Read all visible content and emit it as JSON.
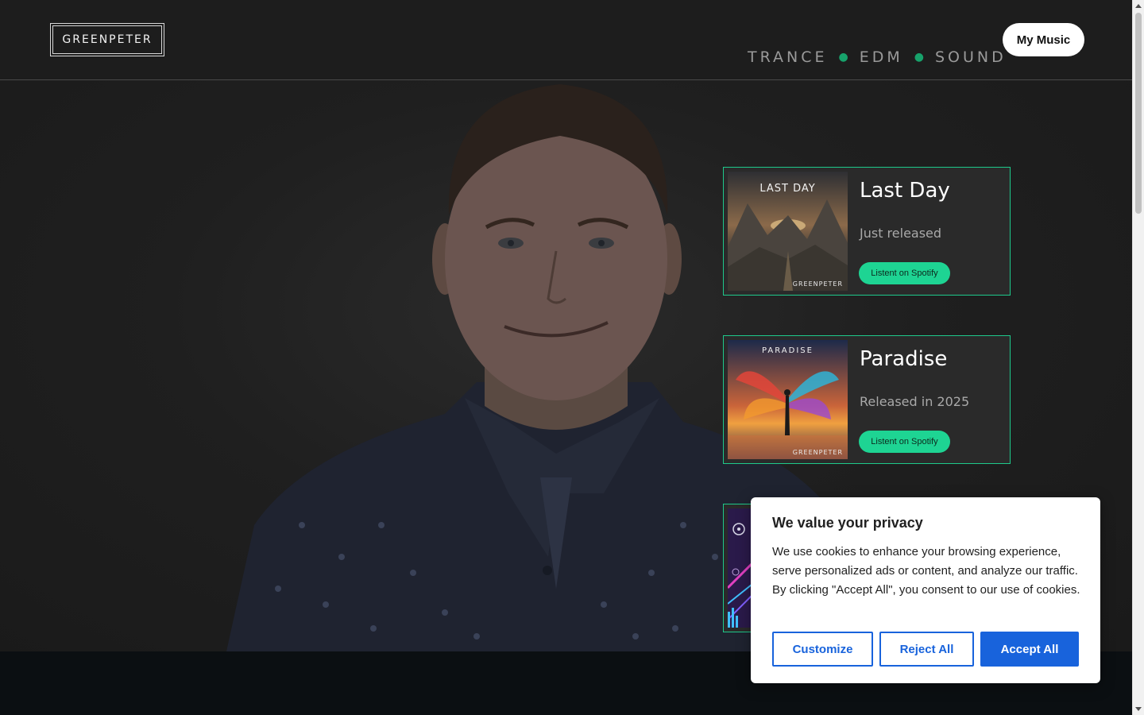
{
  "header": {
    "logo": "GREENPETER",
    "tagline": [
      "TRANCE",
      "EDM",
      "SOUND"
    ],
    "my_music": "My Music"
  },
  "releases": [
    {
      "cover_text": "LAST DAY",
      "cover_brand": "GREENPETER",
      "title": "Last Day",
      "subtitle": "Just released",
      "button": "Listent on Spotify"
    },
    {
      "cover_text": "PARADISE",
      "cover_brand": "GREENPETER",
      "title": "Paradise",
      "subtitle": "Released in 2025",
      "button": "Listent on Spotify"
    },
    {
      "cover_text": "",
      "cover_brand": "",
      "title": "",
      "subtitle": "",
      "button": ""
    }
  ],
  "cookie": {
    "title": "We value your privacy",
    "body": "We use cookies to enhance your browsing experience, serve personalized ads or content, and analyze our traffic. By clicking \"Accept All\", you consent to our use of cookies.",
    "customize": "Customize",
    "reject": "Reject All",
    "accept": "Accept All"
  },
  "colors": {
    "accent_green": "#1ed493",
    "card_border": "#1ec98b",
    "cookie_blue": "#1863dc"
  }
}
